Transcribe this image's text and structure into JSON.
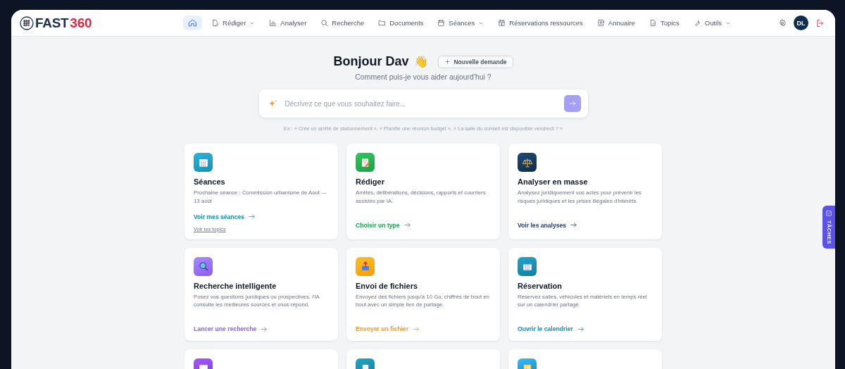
{
  "brand": {
    "name": "FAST",
    "number": "360"
  },
  "nav": [
    {
      "kind": "home",
      "selected": true,
      "dropdown": false
    },
    {
      "label": "Rédiger",
      "kind": "edit",
      "selected": false,
      "dropdown": true
    },
    {
      "label": "Analyser",
      "kind": "chart",
      "selected": false,
      "dropdown": false
    },
    {
      "label": "Recherche",
      "kind": "search",
      "selected": false,
      "dropdown": false
    },
    {
      "label": "Documents",
      "kind": "folder",
      "selected": false,
      "dropdown": false
    },
    {
      "label": "Séances",
      "kind": "calendar",
      "selected": false,
      "dropdown": true
    },
    {
      "label": "Réservations ressources",
      "kind": "calendar-plus",
      "selected": false,
      "dropdown": false
    },
    {
      "label": "Annuaire",
      "kind": "contact",
      "selected": false,
      "dropdown": false
    },
    {
      "label": "Topics",
      "kind": "file",
      "selected": false,
      "dropdown": false
    },
    {
      "label": "Outils",
      "kind": "wrench",
      "selected": false,
      "dropdown": true
    }
  ],
  "user": {
    "initials": "DL"
  },
  "greeting": {
    "title": "Bonjour Dav",
    "emoji": "👋",
    "new_request": "Nouvelle demande",
    "subtitle": "Comment puis-je vous aider aujourd'hui ?"
  },
  "prompt": {
    "placeholder": "Décrivez ce que vous souhaitez faire...",
    "examples": "Ex : « Crée un arrêté de stationnement », « Planifie une réunion budget », « La salle du conseil est disponible vendredi ? »"
  },
  "cards": [
    {
      "kind": "feature",
      "title": "Séances",
      "description": "Prochaine séance : Commission urbanisme de Aout — 13 août",
      "link": "Voir mes séances",
      "color": "#0e8fb0",
      "secondary_link": "Voir les topics"
    },
    {
      "kind": "feature",
      "title": "Rédiger",
      "description": "Arrêtés, délibérations, décisions, rapports et courriers assistés par IA.",
      "link": "Choisir un type",
      "color": "#16a34a"
    },
    {
      "kind": "feature",
      "title": "Analyser en masse",
      "description": "Analysez juridiquement vos actes pour prévenir les risques juridiques et les prises illégales d'intérêts.",
      "link": "Voir les analyses",
      "color": "#1e3a5f"
    },
    {
      "kind": "feature",
      "title": "Recherche intelligente",
      "description": "Posez vos questions juridiques ou prospectives, l'IA consulte les meilleures sources et vous répond.",
      "link": "Lancer une recherche",
      "color": "#8b5cf6"
    },
    {
      "kind": "feature",
      "title": "Envoi de fichiers",
      "description": "Envoyez des fichiers jusqu'à 10 Go, chiffrés de bout en bout avec un simple lien de partage.",
      "link": "Envoyer un fichier",
      "color": "#f59e0b"
    },
    {
      "kind": "feature",
      "title": "Réservation",
      "description": "Réservez salles, véhicules et matériels en temps réel sur un calendrier partagé.",
      "link": "Ouvrir le calendrier",
      "color": "#0e8fb0"
    },
    {
      "kind": "partial"
    },
    {
      "kind": "partial"
    },
    {
      "kind": "partial"
    }
  ],
  "tasks_tab": {
    "label": "TÂCHES"
  }
}
